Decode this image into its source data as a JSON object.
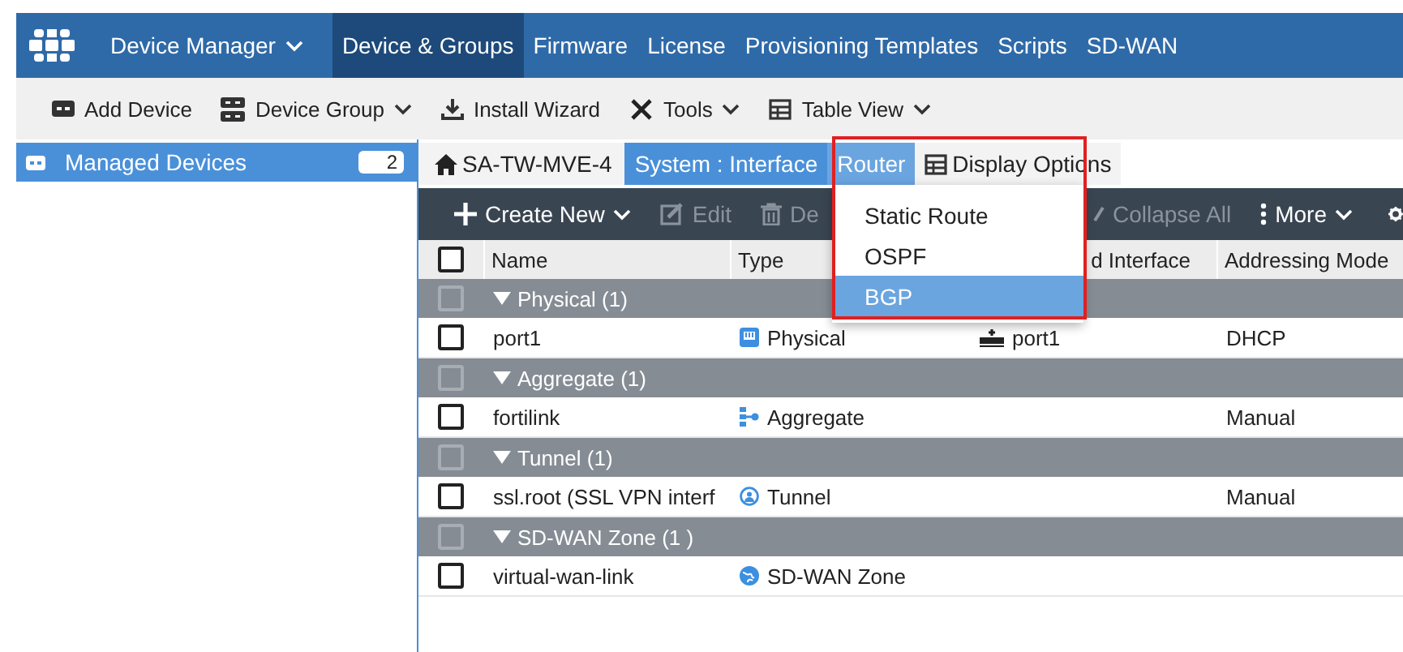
{
  "nav": {
    "items": [
      {
        "label": "Device Manager",
        "caret": true,
        "selected": false
      },
      {
        "label": "Device & Groups",
        "caret": false,
        "selected": true
      },
      {
        "label": "Firmware",
        "caret": false,
        "selected": false
      },
      {
        "label": "License",
        "caret": false,
        "selected": false
      },
      {
        "label": "Provisioning Templates",
        "caret": false,
        "selected": false
      },
      {
        "label": "Scripts",
        "caret": false,
        "selected": false
      },
      {
        "label": "SD-WAN",
        "caret": false,
        "selected": false
      }
    ]
  },
  "toolbar": [
    {
      "label": "Add Device",
      "caret": false
    },
    {
      "label": "Device Group",
      "caret": true
    },
    {
      "label": "Install Wizard",
      "caret": false
    },
    {
      "label": "Tools",
      "caret": true
    },
    {
      "label": "Table View",
      "caret": true
    }
  ],
  "sidebar": {
    "items": [
      {
        "label": "Managed Devices",
        "count": "2",
        "selected": true
      }
    ]
  },
  "tabs": [
    {
      "label": "SA-TW-MVE-4",
      "kind": "home",
      "selected": false
    },
    {
      "label": "System : Interface",
      "kind": "section",
      "selected": false
    },
    {
      "label": "Router",
      "kind": "section",
      "selected": true
    },
    {
      "label": "Display Options",
      "kind": "options",
      "selected": false
    }
  ],
  "router_menu": {
    "items": [
      {
        "label": "Static Route",
        "selected": false
      },
      {
        "label": "OSPF",
        "selected": false
      },
      {
        "label": "BGP",
        "selected": true
      }
    ]
  },
  "table_toolbar": {
    "left": [
      {
        "label": "Create New",
        "caret": true,
        "disabled": false
      },
      {
        "label": "Edit",
        "caret": false,
        "disabled": true
      },
      {
        "label": "De",
        "caret": false,
        "disabled": true
      }
    ],
    "right": [
      {
        "label": "Collapse All",
        "caret": false,
        "disabled": true
      },
      {
        "label": "More",
        "caret": true,
        "disabled": false
      }
    ]
  },
  "table": {
    "select_all_checked": false,
    "columns": [
      "Name",
      "Type",
      "d Interface",
      "Addressing Mode"
    ],
    "groups": [
      {
        "label": "Physical (1)",
        "expanded": true,
        "checked": false,
        "rows": [
          {
            "name": "port1",
            "type": "Physical",
            "interface": "port1",
            "addressing": "DHCP",
            "checked": false
          }
        ]
      },
      {
        "label": "Aggregate (1)",
        "expanded": true,
        "checked": false,
        "rows": [
          {
            "name": "fortilink",
            "type": "Aggregate",
            "addressing": "Manual",
            "checked": false
          }
        ]
      },
      {
        "label": "Tunnel (1)",
        "expanded": true,
        "checked": false,
        "rows": [
          {
            "name": "ssl.root (SSL VPN interf",
            "type": "Tunnel",
            "addressing": "Manual",
            "checked": false
          }
        ]
      },
      {
        "label": "SD-WAN Zone (1 )",
        "expanded": true,
        "checked": false,
        "rows": [
          {
            "name": "virtual-wan-link",
            "type": "SD-WAN Zone",
            "checked": false
          }
        ]
      }
    ]
  }
}
